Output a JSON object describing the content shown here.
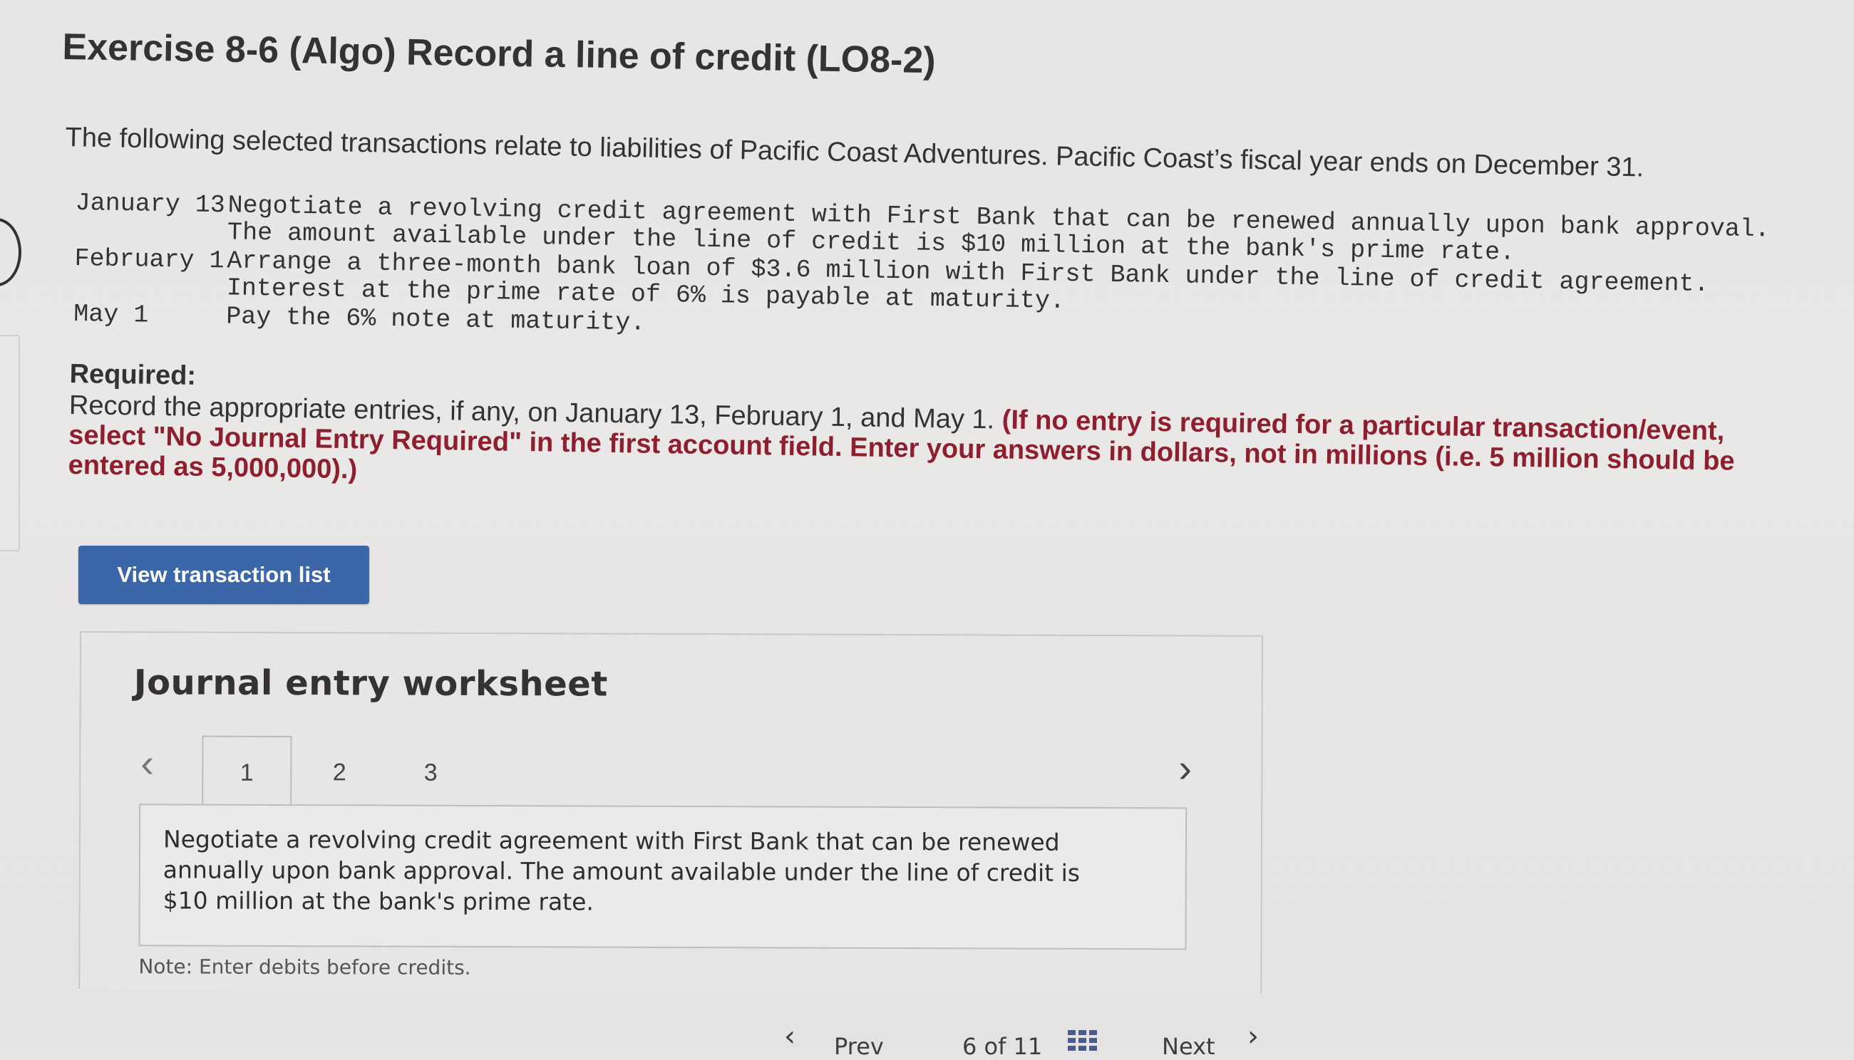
{
  "title": "Exercise 8-6 (Algo) Record a line of credit (LO8-2)",
  "intro": "The following selected transactions relate to liabilities of Pacific Coast Adventures. Pacific Coast’s fiscal year ends on December 31.",
  "transactions": [
    {
      "date": "January 13",
      "description": "Negotiate a revolving credit agreement with First Bank that can be renewed annually upon bank approval. The amount available under the line of credit is $10 million at the bank's prime rate."
    },
    {
      "date": "February 1",
      "description": "Arrange a three-month bank loan of $3.6 million with First Bank under the line of credit agreement. Interest at the prime rate of 6% is payable at maturity."
    },
    {
      "date": "May 1",
      "description": "Pay the 6% note at maturity."
    }
  ],
  "required": {
    "heading": "Required:",
    "text": "Record the appropriate entries, if any, on January 13, February 1, and May 1.",
    "instruction": "(If no entry is required for a particular transaction/event, select \"No Journal Entry Required\" in the first account field. Enter your answers in dollars, not in millions (i.e. 5 million should be entered as 5,000,000).)"
  },
  "view_button_label": "View transaction list",
  "worksheet": {
    "title": "Journal entry worksheet",
    "tabs": [
      "1",
      "2",
      "3"
    ],
    "active_tab": "1",
    "panel_text": "Negotiate a revolving credit agreement with First Bank that can be renewed annually upon bank approval. The amount available under the line of credit is $10 million at the bank's prime rate.",
    "note": "Note: Enter debits before credits."
  },
  "footer": {
    "prev_label": "Prev",
    "page_indicator": "6 of 11",
    "next_label": "Next"
  },
  "icons": {
    "prev": "chevron-left-icon",
    "next": "chevron-right-icon",
    "grid": "grid-icon"
  }
}
